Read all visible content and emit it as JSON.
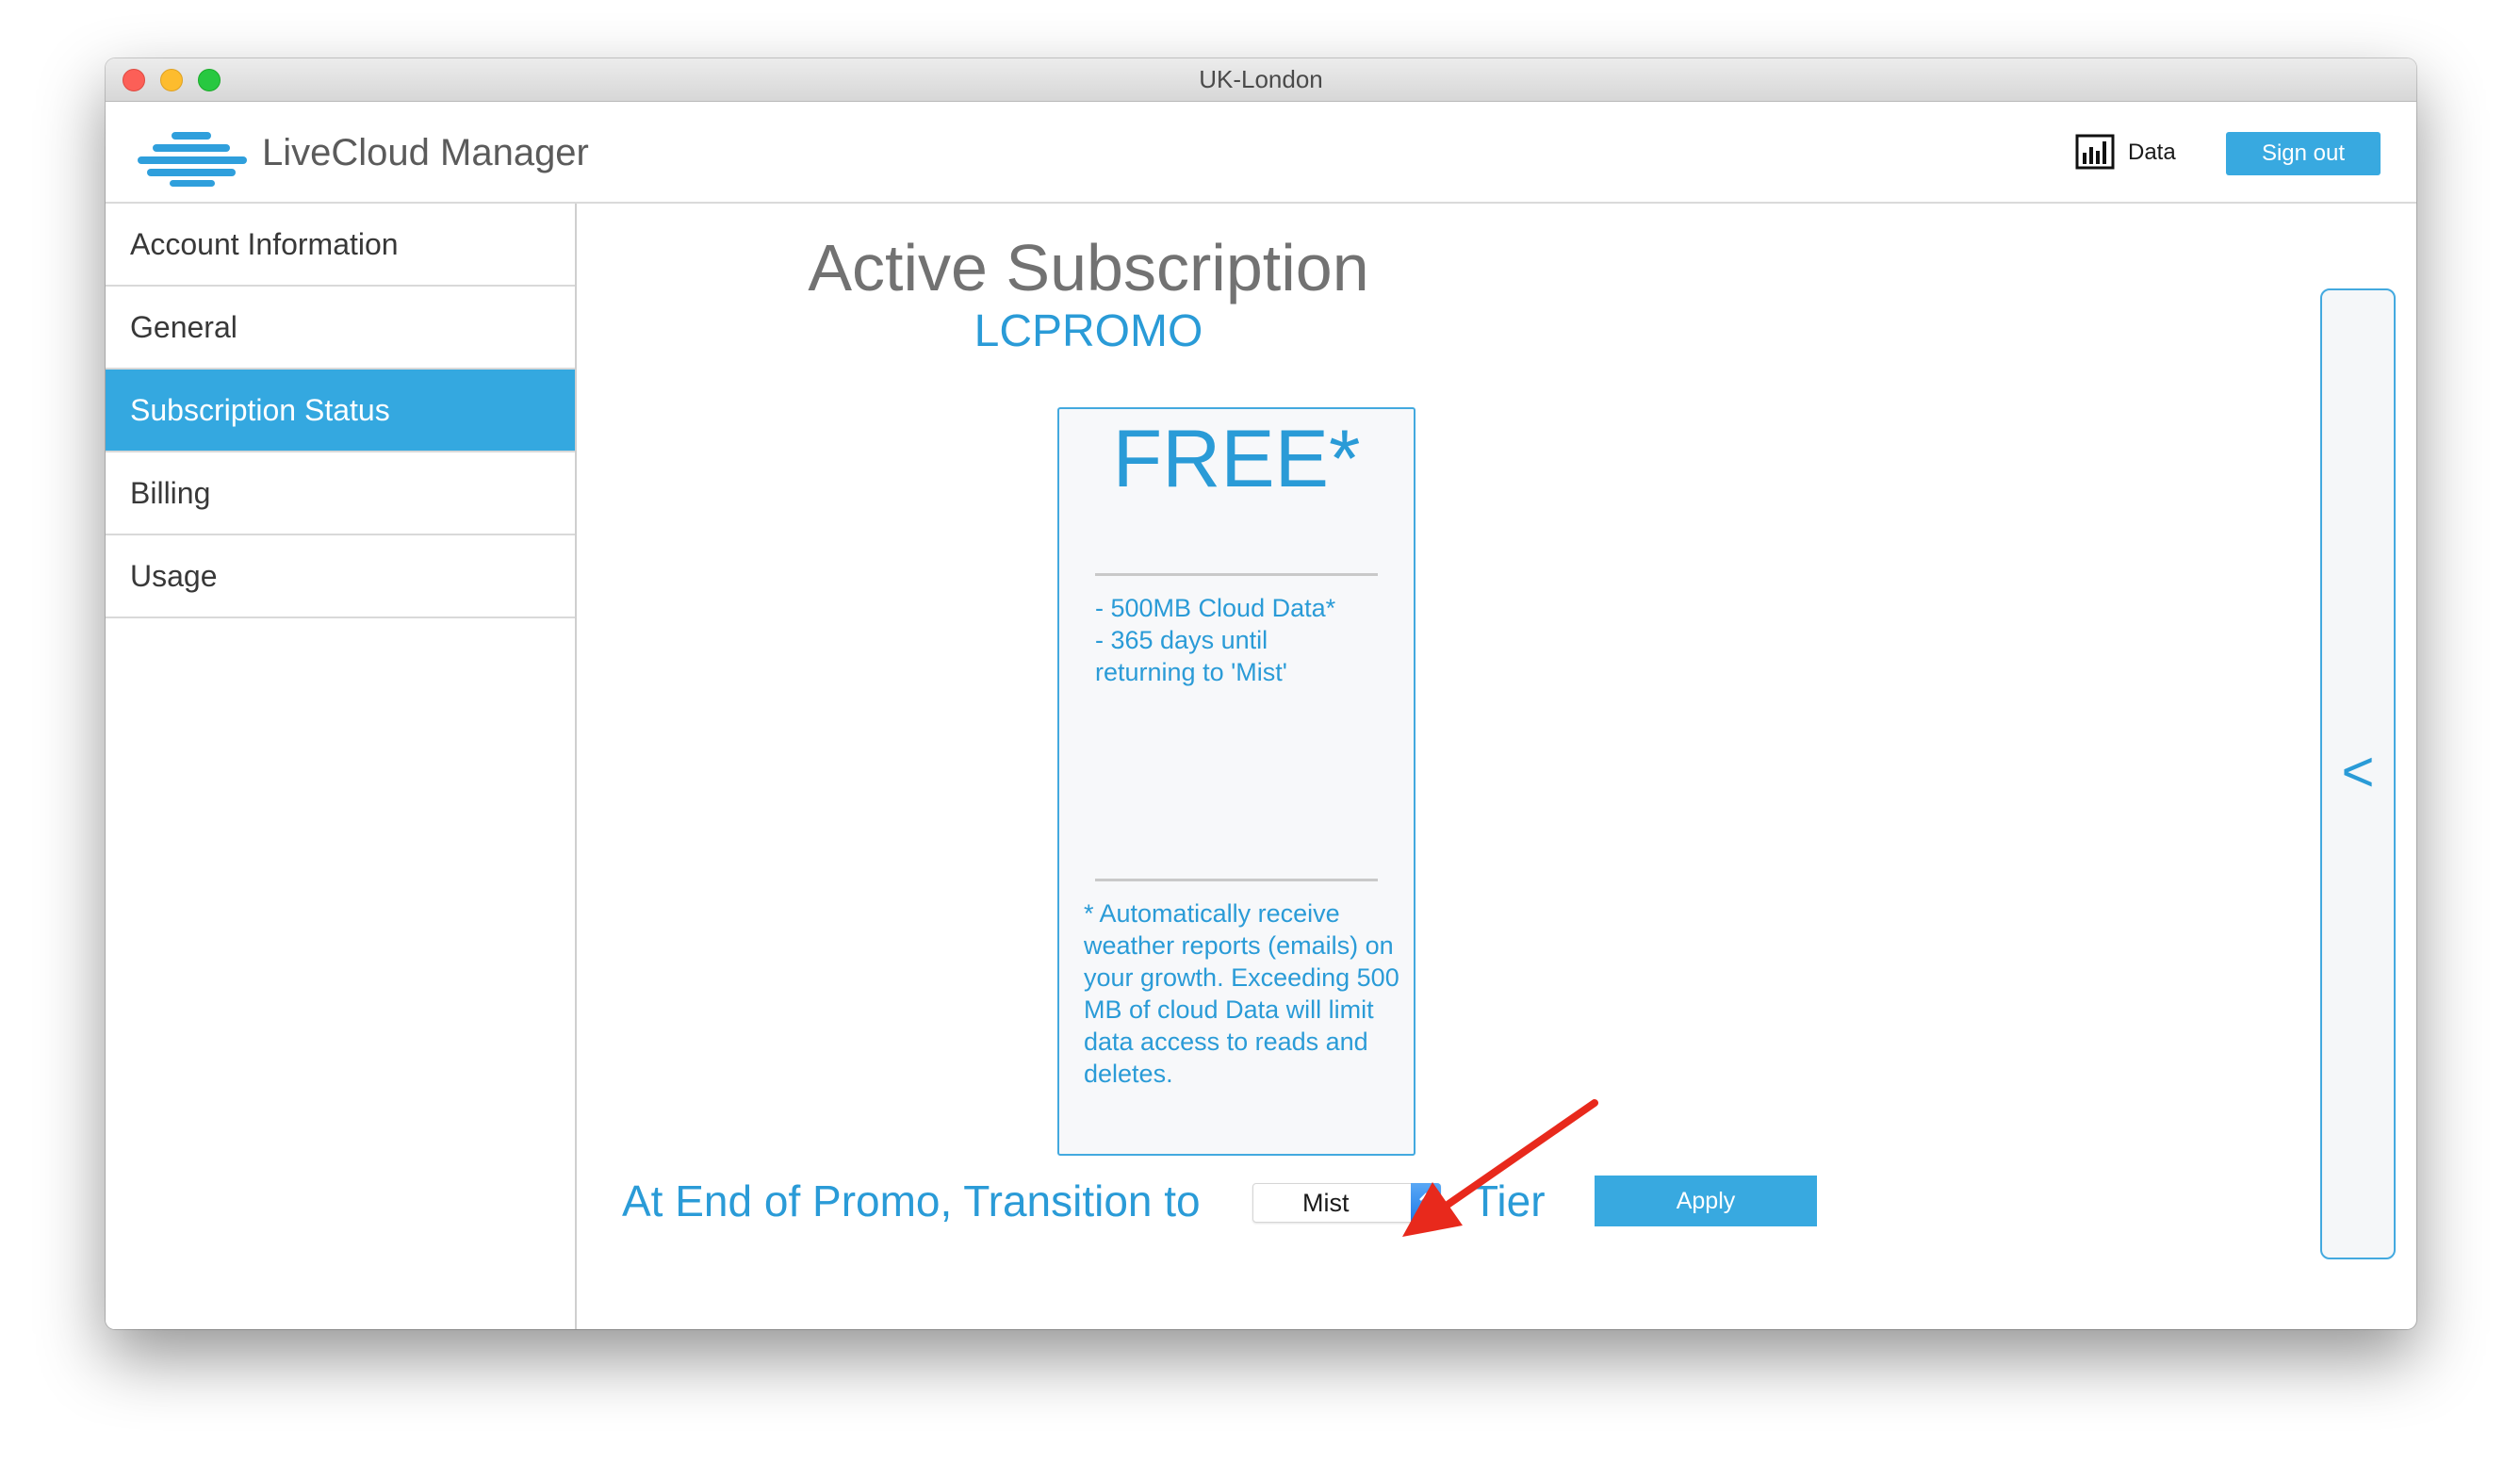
{
  "window": {
    "title": "UK-London"
  },
  "header": {
    "app_name": "LiveCloud Manager",
    "data_label": "Data",
    "signout_label": "Sign out"
  },
  "sidebar": {
    "items": [
      {
        "label": "Account Information",
        "active": false
      },
      {
        "label": "General",
        "active": false
      },
      {
        "label": "Subscription Status",
        "active": true
      },
      {
        "label": "Billing",
        "active": false
      },
      {
        "label": "Usage",
        "active": false
      }
    ]
  },
  "main": {
    "title": "Active Subscription",
    "promo_code": "LCPROMO",
    "card": {
      "price": "FREE*",
      "features": [
        "- 500MB Cloud Data*",
        "- 365 days until",
        "returning to 'Mist'"
      ],
      "note": "* Automatically receive weather reports (emails) on your growth. Exceeding 500 MB of cloud Data will limit data access to reads and deletes."
    },
    "transition": {
      "label": "At End of Promo, Transition to",
      "selected_tier": "Mist",
      "suffix": "Tier",
      "apply_label": "Apply"
    },
    "collapse_glyph": "<"
  },
  "colors": {
    "accent": "#34a8e0",
    "text_blue": "#2a9bd7",
    "annotation_arrow": "#e8291c"
  },
  "icons": [
    "logo-cloud-icon",
    "bar-chart-icon",
    "chevron-updown-icon",
    "chevron-left-icon"
  ]
}
